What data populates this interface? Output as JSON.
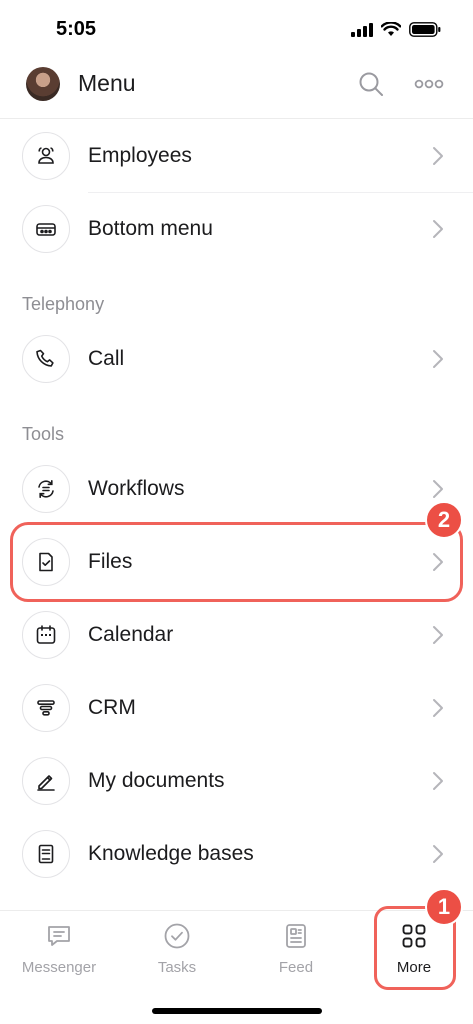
{
  "status_bar": {
    "time": "5:05"
  },
  "header": {
    "title": "Menu"
  },
  "sections": [
    {
      "label": "",
      "items": [
        {
          "label": "Employees",
          "icon": "employees-icon"
        },
        {
          "label": "Bottom menu",
          "icon": "bottom-menu-icon"
        }
      ]
    },
    {
      "label": "Telephony",
      "items": [
        {
          "label": "Call",
          "icon": "phone-icon"
        }
      ]
    },
    {
      "label": "Tools",
      "items": [
        {
          "label": "Workflows",
          "icon": "workflows-icon"
        },
        {
          "label": "Files",
          "icon": "file-check-icon"
        },
        {
          "label": "Calendar",
          "icon": "calendar-icon"
        },
        {
          "label": "CRM",
          "icon": "crm-funnel-icon"
        },
        {
          "label": "My documents",
          "icon": "pen-document-icon"
        },
        {
          "label": "Knowledge bases",
          "icon": "book-icon"
        }
      ]
    }
  ],
  "annotations": {
    "badge_1": "1",
    "badge_2": "2",
    "highlight_color": "#f0625a"
  },
  "tabbar": {
    "tabs": [
      {
        "label": "Messenger",
        "icon": "chat-icon",
        "active": false
      },
      {
        "label": "Tasks",
        "icon": "check-circle-icon",
        "active": false
      },
      {
        "label": "Feed",
        "icon": "feed-icon",
        "active": false
      },
      {
        "label": "More",
        "icon": "grid-icon",
        "active": true
      }
    ]
  }
}
